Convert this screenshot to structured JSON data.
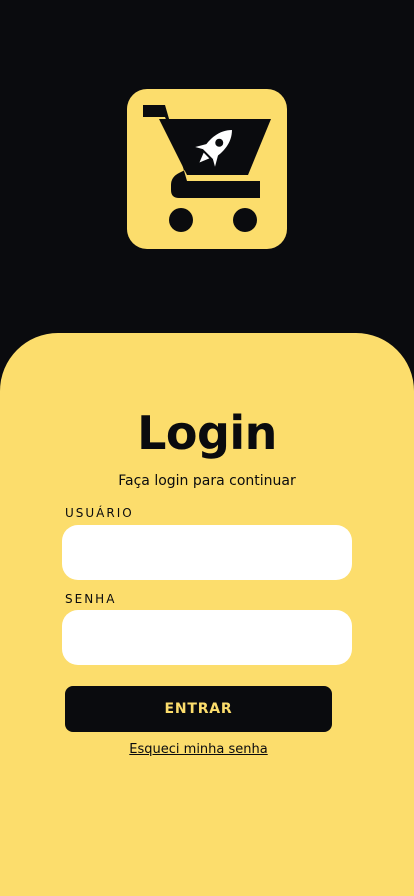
{
  "colors": {
    "background": "#0a0b0e",
    "accent": "#fcdd6c",
    "input_bg": "#ffffff",
    "text": "#0a0b0e"
  },
  "logo": {
    "icon": "shopping-cart-rocket-icon"
  },
  "login": {
    "title": "Login",
    "subtitle": "Faça login para continuar",
    "username_label": "USUÁRIO",
    "username_value": "",
    "password_label": "SENHA",
    "password_value": "",
    "submit_label": "ENTRAR",
    "forgot_label": "Esqueci minha senha"
  }
}
